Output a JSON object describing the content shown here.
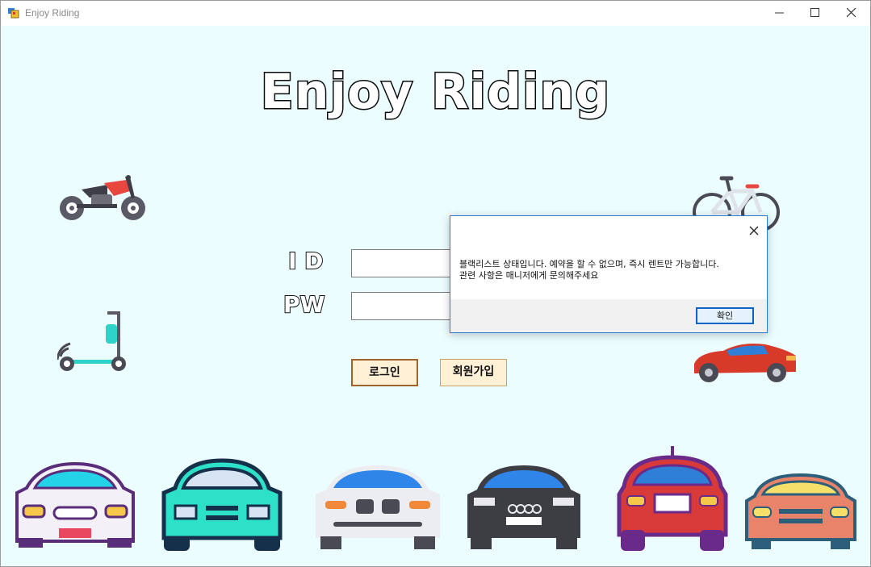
{
  "window": {
    "title": "Enjoy Riding"
  },
  "brand": {
    "title": "Enjoy Riding"
  },
  "login": {
    "id_label": "I D",
    "pw_label": "PW",
    "id_value": "",
    "pw_value": "",
    "login_button": "로그인",
    "signup_button": "회원가입"
  },
  "dialog": {
    "line1": "블랙리스트 상태입니다. 예약을 할 수 없으며, 즉시 렌트만 가능합니다.",
    "line2": "관련 사항은 매니저에게 문의해주세요",
    "ok_label": "확인"
  },
  "icons": {
    "motorcycle": "motorcycle-icon",
    "bicycle": "bicycle-icon",
    "scooter": "kick-scooter-icon",
    "sports_car": "sports-car-icon"
  },
  "colors": {
    "background": "#ecfdff",
    "button_fill": "#fff0d6",
    "button_border": "#a0642a",
    "dialog_border": "#2b7bd1"
  }
}
